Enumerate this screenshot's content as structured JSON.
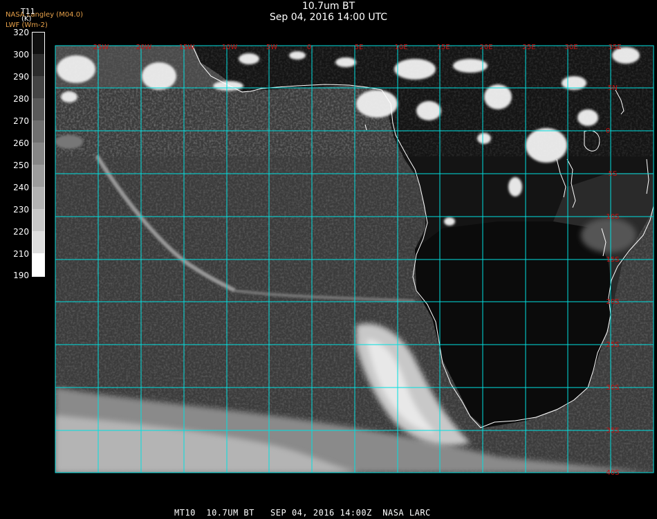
{
  "header": {
    "title": "10.7um BT",
    "subtitle": "Sep 04, 2016 14:00 UTC",
    "credit_line1": "NASA Langley (M04.0)",
    "credit_line2": "LWF (Wm-2)"
  },
  "colorbar": {
    "title": "T11",
    "unit": "(K)",
    "ticks": [
      "320",
      "300",
      "290",
      "280",
      "270",
      "260",
      "250",
      "240",
      "230",
      "220",
      "210",
      "190"
    ]
  },
  "map": {
    "lon_labels": [
      "25W",
      "20W",
      "15W",
      "10W",
      "5W",
      "0",
      "5E",
      "10E",
      "15E",
      "20E",
      "25E",
      "30E",
      "35E"
    ],
    "lat_labels": [
      "5N",
      "0",
      "5S",
      "10S",
      "15S",
      "20S",
      "25S",
      "30S",
      "35S",
      "40S"
    ],
    "grid_color": "#00e0e0",
    "label_color": "#cc1010",
    "coast_color": "#ffffff"
  },
  "footer": {
    "text": "MT10  10.7UM BT   SEP 04, 2016 14:00Z  NASA LARC"
  }
}
